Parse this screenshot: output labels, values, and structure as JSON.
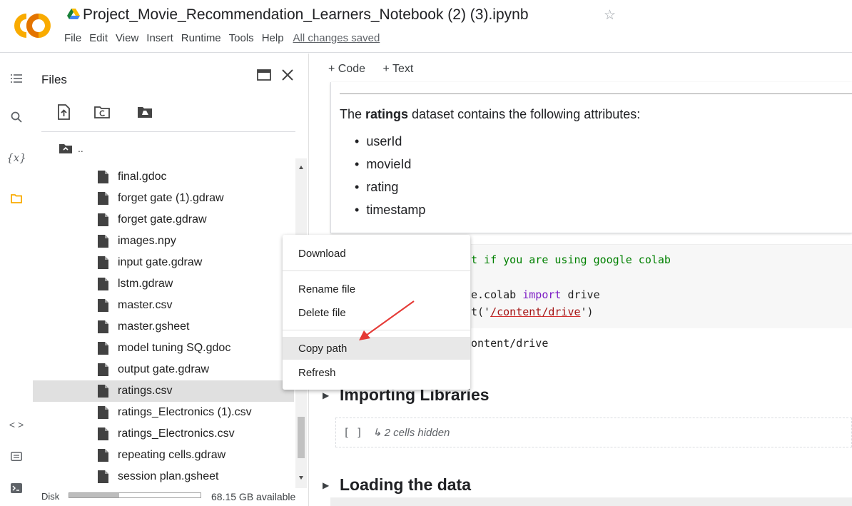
{
  "header": {
    "title": "Project_Movie_Recommendation_Learners_Notebook (2) (3).ipynb",
    "menu": [
      "File",
      "Edit",
      "View",
      "Insert",
      "Runtime",
      "Tools",
      "Help"
    ],
    "save_status": "All changes saved"
  },
  "files_panel": {
    "title": "Files",
    "parent_label": "..",
    "files": [
      "final.gdoc",
      "forget gate (1).gdraw",
      "forget gate.gdraw",
      "images.npy",
      "input gate.gdraw",
      "lstm.gdraw",
      "master.csv",
      "master.gsheet",
      "model tuning SQ.gdoc",
      "output gate.gdraw",
      "ratings.csv",
      "ratings_Electronics (1).csv",
      "ratings_Electronics.csv",
      "repeating cells.gdraw",
      "session plan.gsheet"
    ],
    "selected_index": 10,
    "disk_label": "Disk",
    "disk_available": "68.15 GB available",
    "disk_used_fraction": 0.38
  },
  "context_menu": {
    "items": [
      "Download",
      "Rename file",
      "Delete file",
      "Copy path",
      "Refresh"
    ],
    "highlighted": "Copy path"
  },
  "notebook": {
    "toolbar": [
      "+ Code",
      "+ Text"
    ],
    "text_cell": {
      "para_before": "The ",
      "para_bold": "ratings",
      "para_after": " dataset contains the following attributes:",
      "attributes": [
        "userId",
        "movieId",
        "rating",
        "timestamp"
      ]
    },
    "code_cell": {
      "line1": "t if you are using google colab",
      "line2_pre": "e.colab ",
      "line2_kw": "import",
      "line2_post": " drive",
      "line3_pre": "t('",
      "line3_str": "/content/drive",
      "line3_post": "')",
      "output": "ontent/drive"
    },
    "sections": [
      {
        "title": "Importing Libraries",
        "hidden": "2 cells hidden"
      },
      {
        "title": "Loading the data"
      }
    ]
  },
  "colors": {
    "accent_orange": "#f9ab00",
    "logo_orange": "#f9ab00",
    "arrow_red": "#e53935"
  }
}
